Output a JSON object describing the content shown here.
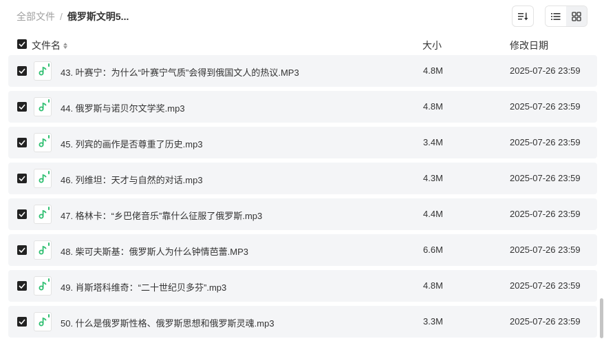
{
  "breadcrumb": {
    "root": "全部文件",
    "separator": "/",
    "current": "俄罗斯文明5..."
  },
  "toolbar": {
    "sort_icon": "sort-lines-icon",
    "list_icon": "list-view-icon",
    "grid_icon": "grid-view-icon"
  },
  "header": {
    "name": "文件名",
    "size": "大小",
    "modified": "修改日期"
  },
  "colors": {
    "accent": "#2fbf71",
    "row_bg": "#f4f5f7",
    "checkbox": "#222222"
  },
  "files": [
    {
      "name": "43. 叶赛宁：为什么“叶赛宁气质”会得到俄国文人的热议.MP3",
      "size": "4.8M",
      "date": "2025-07-26 23:59",
      "checked": true
    },
    {
      "name": "44. 俄罗斯与诺贝尔文学奖.mp3",
      "size": "4.8M",
      "date": "2025-07-26 23:59",
      "checked": true
    },
    {
      "name": "45. 列宾的画作是否尊重了历史.mp3",
      "size": "3.4M",
      "date": "2025-07-26 23:59",
      "checked": true
    },
    {
      "name": "46. 列维坦：天才与自然的对话.mp3",
      "size": "4.3M",
      "date": "2025-07-26 23:59",
      "checked": true
    },
    {
      "name": "47. 格林卡：“乡巴佬音乐”靠什么征服了俄罗斯.mp3",
      "size": "4.4M",
      "date": "2025-07-26 23:59",
      "checked": true
    },
    {
      "name": "48. 柴可夫斯基：俄罗斯人为什么钟情芭蕾.MP3",
      "size": "6.6M",
      "date": "2025-07-26 23:59",
      "checked": true
    },
    {
      "name": "49. 肖斯塔科维奇：“二十世纪贝多芬”.mp3",
      "size": "4.8M",
      "date": "2025-07-26 23:59",
      "checked": true
    },
    {
      "name": "50. 什么是俄罗斯性格、俄罗斯思想和俄罗斯灵魂.mp3",
      "size": "3.3M",
      "date": "2025-07-26 23:59",
      "checked": true
    }
  ]
}
